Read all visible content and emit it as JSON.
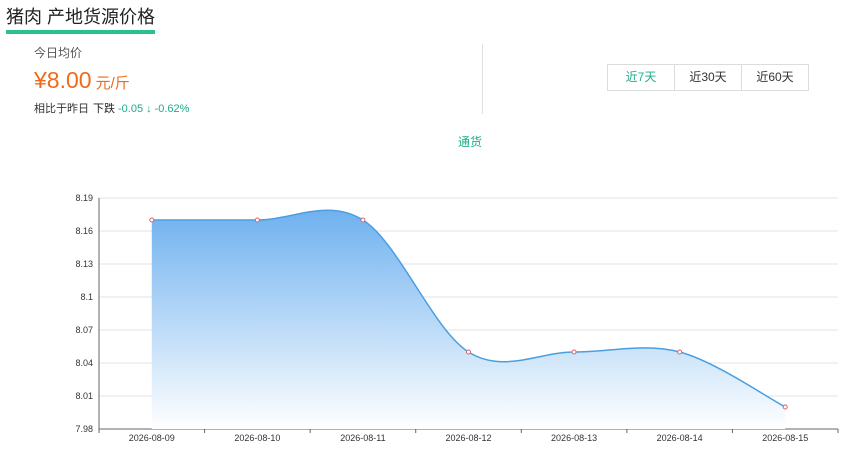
{
  "header": {
    "title": "猪肉 产地货源价格"
  },
  "summary": {
    "today_label": "今日均价",
    "price": "¥8.00",
    "unit": "元/斤",
    "compare_label": "相比于昨日",
    "trend": "下跌",
    "delta": "-0.05",
    "arrow": "↓",
    "pct": "-0.62%"
  },
  "range_tabs": [
    {
      "label": "近7天",
      "active": true
    },
    {
      "label": "近30天",
      "active": false
    },
    {
      "label": "近60天",
      "active": false
    }
  ],
  "series_label": "通货",
  "colors": {
    "accent": "#1cae8a",
    "price": "#f06a1a",
    "line": "#4a9fe0",
    "area_top": "#6fb1ef",
    "area_bottom": "#ffffff"
  },
  "chart_data": {
    "type": "area",
    "x": [
      "2026-08-09",
      "2026-08-10",
      "2026-08-11",
      "2026-08-12",
      "2026-08-13",
      "2026-08-14",
      "2026-08-15"
    ],
    "series": [
      {
        "name": "通货",
        "values": [
          8.17,
          8.17,
          8.17,
          8.05,
          8.05,
          8.05,
          8.0
        ]
      }
    ],
    "yticks": [
      "7.98",
      "8.01",
      "8.04",
      "8.07",
      "8.1",
      "8.13",
      "8.16",
      "8.19"
    ],
    "ylim": [
      7.98,
      8.19
    ],
    "grid": true
  }
}
